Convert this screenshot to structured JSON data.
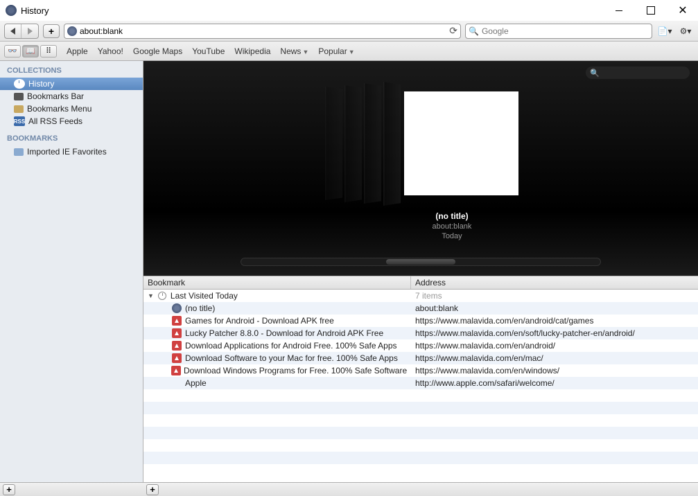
{
  "window": {
    "title": "History"
  },
  "toolbar": {
    "url": "about:blank",
    "search_placeholder": "Google"
  },
  "bookmarks_bar": {
    "items": [
      "Apple",
      "Yahoo!",
      "Google Maps",
      "YouTube",
      "Wikipedia"
    ],
    "dropdowns": [
      "News",
      "Popular"
    ]
  },
  "sidebar": {
    "collections_header": "COLLECTIONS",
    "collections": [
      {
        "label": "History",
        "icon": "clock",
        "selected": true
      },
      {
        "label": "Bookmarks Bar",
        "icon": "bookmark",
        "selected": false
      },
      {
        "label": "Bookmarks Menu",
        "icon": "folder",
        "selected": false
      },
      {
        "label": "All RSS Feeds",
        "icon": "rss",
        "selected": false
      }
    ],
    "bookmarks_header": "BOOKMARKS",
    "bookmarks": [
      {
        "label": "Imported IE Favorites",
        "icon": "folder-blue"
      }
    ]
  },
  "coverflow": {
    "title": "(no title)",
    "subtitle": "about:blank",
    "date": "Today"
  },
  "history_table": {
    "col_bookmark": "Bookmark",
    "col_address": "Address",
    "group": {
      "label": "Last Visited Today",
      "count": "7 items"
    },
    "rows": [
      {
        "icon": "globe",
        "title": "(no title)",
        "url": "about:blank"
      },
      {
        "icon": "mv",
        "title": "Games for Android - Download APK free",
        "url": "https://www.malavida.com/en/android/cat/games"
      },
      {
        "icon": "mv",
        "title": "Lucky Patcher 8.8.0 - Download for Android APK Free",
        "url": "https://www.malavida.com/en/soft/lucky-patcher-en/android/"
      },
      {
        "icon": "mv",
        "title": "Download Applications for Android Free. 100% Safe Apps",
        "url": "https://www.malavida.com/en/android/"
      },
      {
        "icon": "mv",
        "title": "Download Software to your Mac for free. 100% Safe Apps",
        "url": "https://www.malavida.com/en/mac/"
      },
      {
        "icon": "mv",
        "title": "Download Windows Programs for Free. 100% Safe Software",
        "url": "https://www.malavida.com/en/windows/"
      },
      {
        "icon": "apple",
        "title": "Apple",
        "url": "http://www.apple.com/safari/welcome/"
      }
    ]
  }
}
